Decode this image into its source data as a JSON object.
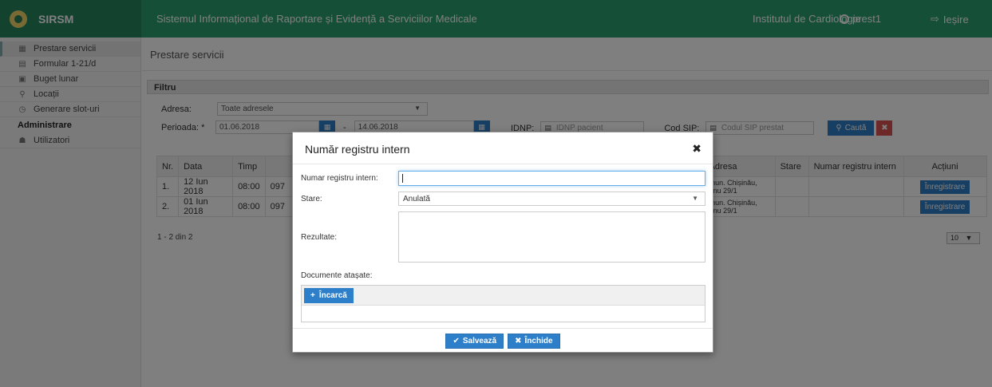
{
  "topbar": {
    "brand": "SIRSM",
    "title": "Sistemul Informațional de Raportare și Evidență a Serviciilor Medicale",
    "institution": "Institutul de Cardiologie",
    "user": "prest1",
    "logout": "Ieșire"
  },
  "sidebar": {
    "items": [
      {
        "label": "Prestare servicii",
        "icon": "calendar-icon"
      },
      {
        "label": "Formular 1-21/d",
        "icon": "document-icon"
      },
      {
        "label": "Buget lunar",
        "icon": "money-icon"
      },
      {
        "label": "Locații",
        "icon": "location-icon"
      },
      {
        "label": "Generare slot-uri",
        "icon": "clock-icon"
      }
    ],
    "admin_heading": "Administrare",
    "admin_items": [
      {
        "label": "Utilizatori",
        "icon": "users-icon"
      }
    ]
  },
  "page": {
    "title": "Prestare servicii"
  },
  "filter": {
    "heading": "Filtru",
    "address_label": "Adresa:",
    "address_value": "Toate adresele",
    "period_label": "Perioada: *",
    "date_from": "01.06.2018",
    "date_sep": "-",
    "date_to": "14.06.2018",
    "idnp_label": "IDNP:",
    "idnp_placeholder": "IDNP pacient",
    "sip_label": "Cod SIP:",
    "sip_placeholder": "Codul SIP prestat",
    "search_label": "Caută"
  },
  "table": {
    "headers": [
      "Nr.",
      "Data",
      "Timp",
      "",
      "Adresa",
      "Stare",
      "Numar registru intern",
      "Acțiuni"
    ],
    "rows": [
      {
        "nr": "1.",
        "date": "12 Iun 2018",
        "time": "08:00",
        "code": "097",
        "address1": "mun. Chișinău,",
        "address2": "anu 29/1",
        "state": "",
        "reg": "",
        "action": "Înregistrare"
      },
      {
        "nr": "2.",
        "date": "01 Iun 2018",
        "time": "08:00",
        "code": "097",
        "address1": "mun. Chișinău,",
        "address2": "anu 29/1",
        "state": "",
        "reg": "",
        "action": "Înregistrare"
      }
    ],
    "pager": "1 - 2 din 2",
    "page_size": "10"
  },
  "modal": {
    "title": "Număr registru intern",
    "reg_label": "Numar registru intern:",
    "reg_value": "",
    "state_label": "Stare:",
    "state_value": "Anulată",
    "results_label": "Rezultate:",
    "docs_label": "Documente atașate:",
    "upload_label": "Încarcă",
    "save_label": "Salvează",
    "close_label": "Închide"
  }
}
